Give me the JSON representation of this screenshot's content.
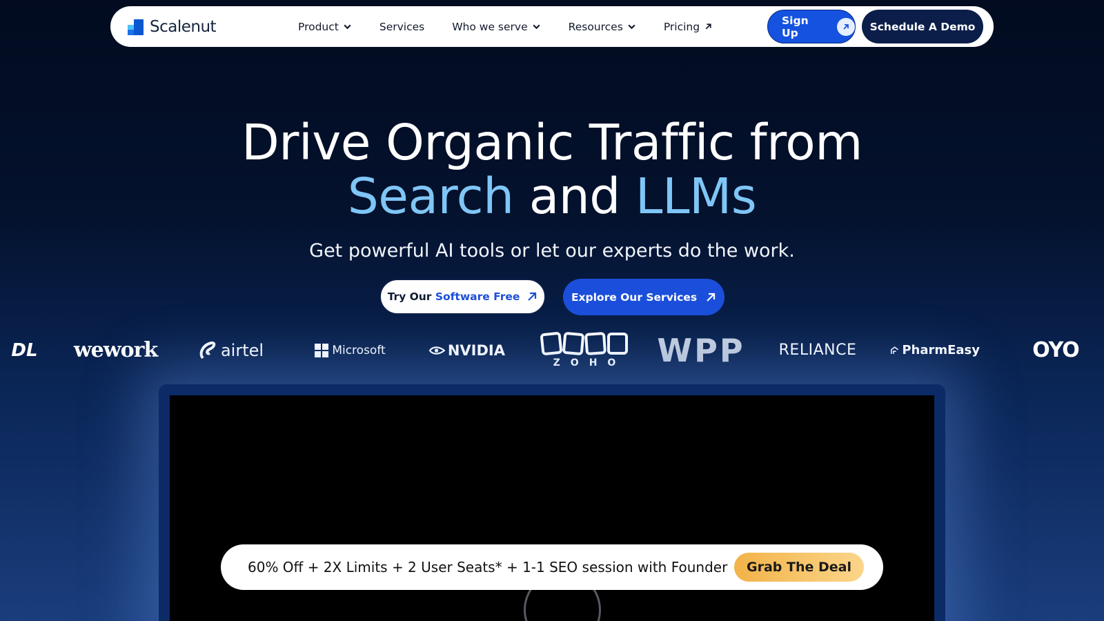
{
  "nav": {
    "brand": "Scalenut",
    "items": [
      {
        "label": "Product",
        "icon": "chevron-down-icon"
      },
      {
        "label": "Services",
        "icon": ""
      },
      {
        "label": "Who we serve",
        "icon": "chevron-down-icon"
      },
      {
        "label": "Resources",
        "icon": "chevron-down-icon"
      },
      {
        "label": "Pricing",
        "icon": "arrow-up-right-icon"
      }
    ],
    "signup_label": "Sign Up",
    "demo_label": "Schedule A Demo"
  },
  "hero": {
    "title_line1": "Drive Organic Traffic from",
    "title_search": "Search",
    "title_and": "and",
    "title_llms": "LLMs",
    "subtitle": "Get powerful AI tools or let our experts do the work.",
    "cta_try_prefix": "Try Our",
    "cta_try_highlight": "Software Free",
    "cta_explore": "Explore Our Services"
  },
  "logos": {
    "dl": "DL",
    "wework": "wework",
    "airtel": "airtel",
    "microsoft": "Microsoft",
    "nvidia": "NVIDIA",
    "zoho": "ZOHO",
    "wpp": "WPP",
    "reliance": "RELIANCE",
    "pharmeasy": "PharmEasy",
    "oyo": "OYO"
  },
  "promo": {
    "text": "60% Off + 2X Limits + 2 User Seats* + 1-1 SEO session with Founder",
    "button": "Grab The Deal"
  },
  "colors": {
    "accent_blue": "#1552e0",
    "highlight_blue": "#7fc6f7",
    "navy": "#0b1e4a",
    "deal_gold": "#f2b349"
  }
}
